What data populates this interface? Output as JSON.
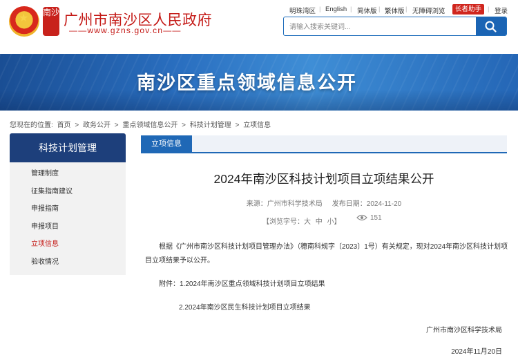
{
  "header": {
    "seal_text": "南沙",
    "site_title": "广州市南沙区人民政府",
    "site_url": "——www.gzns.gov.cn——",
    "top_links": [
      "明珠湾区",
      "English",
      "简体版",
      "繁体版",
      "无障碍浏览"
    ],
    "helper_label": "长者助手",
    "login_label": "登录",
    "search_placeholder": "请输入搜索关键词..."
  },
  "banner": {
    "title": "南沙区重点领域信息公开"
  },
  "breadcrumb": {
    "prefix": "您现在的位置:",
    "items": [
      "首页",
      "政务公开",
      "重点领域信息公开",
      "科技计划管理",
      "立项信息"
    ],
    "separator": ">"
  },
  "sidebar": {
    "heading": "科技计划管理",
    "items": [
      {
        "label": "管理制度",
        "active": false
      },
      {
        "label": "征集指南建议",
        "active": false
      },
      {
        "label": "申报指南",
        "active": false
      },
      {
        "label": "申报项目",
        "active": false
      },
      {
        "label": "立项信息",
        "active": true
      },
      {
        "label": "验收情况",
        "active": false
      }
    ]
  },
  "content": {
    "tab_label": "立项信息",
    "title": "2024年南沙区科技计划项目立项结果公开",
    "source": "来源：广州市科学技术局",
    "publish_date": "发布日期：2024-11-20",
    "font_size_label": "【浏览字号：大",
    "font_mid": "中",
    "font_small": "小】",
    "view_count": "151",
    "paragraph": "根据《广州市南沙区科技计划项目管理办法》（穗南科规字〔2023〕1号）有关规定，现对2024年南沙区科技计划项目立项结果予以公开。",
    "attachment_1": "附件：1.2024年南沙区重点领域科技计划项目立项结果",
    "attachment_2": "2.2024年南沙区民生科技计划项目立项结果",
    "signature_org": "广州市南沙区科学技术局",
    "signature_date": "2024年11月20日"
  },
  "colors": {
    "brand_red": "#c41a17",
    "nav_blue": "#1d3f7b",
    "tab_blue": "#1f68b6"
  },
  "icons": [
    "national-emblem-icon",
    "search-icon",
    "eye-icon"
  ]
}
